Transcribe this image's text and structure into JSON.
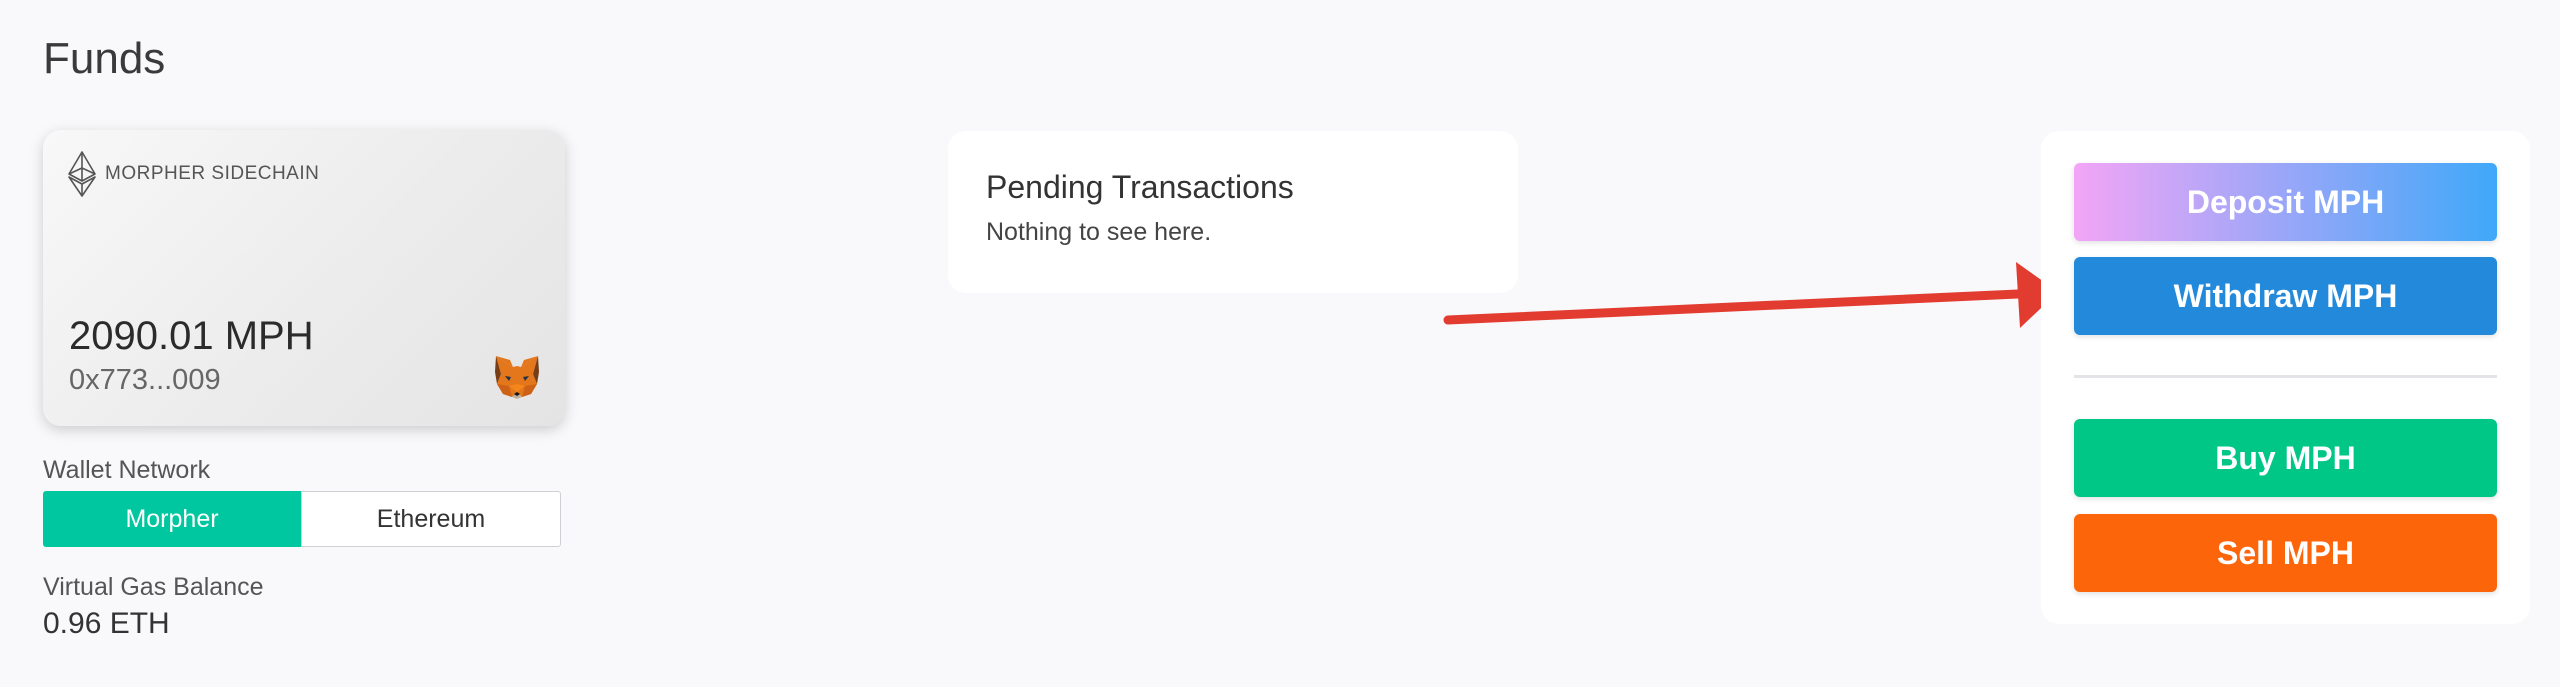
{
  "page": {
    "title": "Funds"
  },
  "wallet_card": {
    "chain_icon": "ethereum-icon",
    "chain_label": "MORPHER SIDECHAIN",
    "balance": "2090.01 MPH",
    "address": "0x773...009",
    "wallet_icon": "metamask-fox-icon"
  },
  "wallet_network": {
    "label": "Wallet Network",
    "options": [
      "Morpher",
      "Ethereum"
    ],
    "selected": "Morpher"
  },
  "gas": {
    "label": "Virtual Gas Balance",
    "value": "0.96 ETH"
  },
  "pending": {
    "title": "Pending Transactions",
    "subtitle": "Nothing to see here."
  },
  "actions": {
    "deposit_label": "Deposit MPH",
    "withdraw_label": "Withdraw MPH",
    "buy_label": "Buy MPH",
    "sell_label": "Sell MPH"
  },
  "colors": {
    "accent_green": "#00c79f",
    "withdraw_blue": "#2389db",
    "buy_green": "#00c686",
    "sell_orange": "#fd650b",
    "arrow_red": "#e23b30"
  }
}
